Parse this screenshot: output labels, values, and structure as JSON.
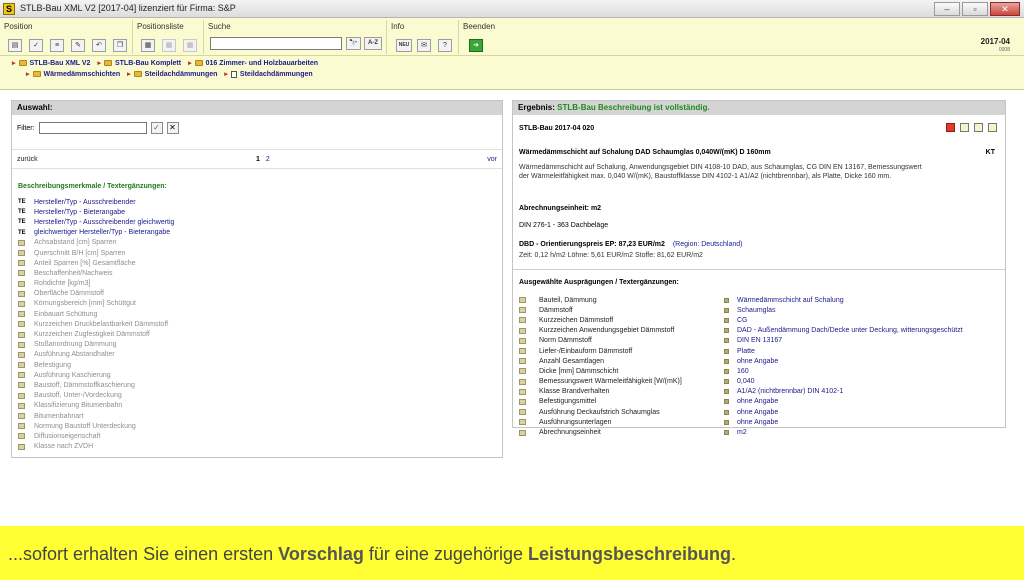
{
  "window": {
    "title": "STLB-Bau XML V2 [2017-04] lizenziert für Firma: S&P",
    "app_icon": "S",
    "minimize": "–",
    "maximize": "▫",
    "close": "✕"
  },
  "ribbon": {
    "groups": [
      "Position",
      "Positionsliste",
      "Suche",
      "Info",
      "Beenden"
    ],
    "search_value": "",
    "search_buttons": [
      "🔭",
      "A-Z"
    ],
    "info_buttons": [
      "NEU",
      "✉",
      "?"
    ],
    "version": "2017-04",
    "build": "0008"
  },
  "breadcrumb": {
    "row1": [
      "STLB-Bau XML V2",
      "STLB-Bau Komplett",
      "016 Zimmer- und Holzbauarbeiten"
    ],
    "row2": [
      "Wärmedämmschichten",
      "Steildachdämmungen",
      "Steildachdämmungen"
    ]
  },
  "left": {
    "header": "Auswahl:",
    "filter_label": "Filter:",
    "filter_value": "",
    "back": "zurück",
    "page_current": "1",
    "page_other": "2",
    "next": "vor",
    "section_title": "Beschreibungsmerkmale / Textergänzungen:",
    "items": [
      {
        "tag": "TE",
        "label": "Hersteller/Typ - Ausschreibender",
        "active": true
      },
      {
        "tag": "TE",
        "label": "Hersteller/Typ - Bieterangabe",
        "active": true
      },
      {
        "tag": "TE",
        "label": "Hersteller/Typ - Ausschreibender gleichwertig",
        "active": true
      },
      {
        "tag": "TE",
        "label": "gleichwertiger Hersteller/Typ - Bieterangabe",
        "active": true
      },
      {
        "tag": "",
        "label": "Achsabstand [cm] Sparren",
        "active": false
      },
      {
        "tag": "",
        "label": "Querschnitt B/H [cm] Sparren",
        "active": false
      },
      {
        "tag": "",
        "label": "Anteil Sparren [%] Gesamtfläche",
        "active": false
      },
      {
        "tag": "",
        "label": "Beschaffenheit/Nachweis",
        "active": false
      },
      {
        "tag": "",
        "label": "Rohdichte [kg/m3]",
        "active": false
      },
      {
        "tag": "",
        "label": "Oberfläche Dämmstoff",
        "active": false
      },
      {
        "tag": "",
        "label": "Körnungsbereich [mm] Schüttgut",
        "active": false
      },
      {
        "tag": "",
        "label": "Einbauart Schüttung",
        "active": false
      },
      {
        "tag": "",
        "label": "Kurzzeichen Druckbelastbarkeit Dämmstoff",
        "active": false
      },
      {
        "tag": "",
        "label": "Kurzzeichen Zugfestigkeit Dämmstoff",
        "active": false
      },
      {
        "tag": "",
        "label": "Stoßanordnung Dämmung",
        "active": false
      },
      {
        "tag": "",
        "label": "Ausführung Abstandhalter",
        "active": false
      },
      {
        "tag": "",
        "label": "Befestigung",
        "active": false
      },
      {
        "tag": "",
        "label": "Ausführung Kaschierung",
        "active": false
      },
      {
        "tag": "",
        "label": "Baustoff, Dämmstoffkaschierung",
        "active": false
      },
      {
        "tag": "",
        "label": "Baustoff, Unter-/Vordeckung",
        "active": false
      },
      {
        "tag": "",
        "label": "Klassifizierung Bitumenbahn",
        "active": false
      },
      {
        "tag": "",
        "label": "Bitumenbahnart",
        "active": false
      },
      {
        "tag": "",
        "label": "Normung Baustoff Unterdeckung",
        "active": false
      },
      {
        "tag": "",
        "label": "Diffusionseigenschaft",
        "active": false
      },
      {
        "tag": "",
        "label": "Klasse nach ZVDH",
        "active": false
      }
    ]
  },
  "right": {
    "header_label": "Ergebnis:",
    "header_status": "STLB-Bau Beschreibung ist vollständig.",
    "version_line": "STLB-Bau 2017-04 020",
    "title": "Wärmedämmschicht auf Schalung DAD Schaumglas 0,040W/(mK) D 160mm",
    "kt": "KT",
    "description": "Wärmedämmschicht auf Schalung, Anwendungsgebiet DIN 4108-10 DAD, aus Schaumglas, CG DIN EN 13167, Bemessungswert der Wärmeleitfähigkeit max. 0,040 W/(mK), Baustoffklasse DIN 4102-1 A1/A2 (nichtbrennbar), als Platte, Dicke 160 mm.",
    "unit": "Abrechnungseinheit: m2",
    "din": "DIN 276-1 - 363 Dachbeläge",
    "price": "DBD - Orientierungspreis EP: 87,23 EUR/m2",
    "region": "(Region: Deutschland)",
    "time": "Zeit: 0,12 h/m2   Löhne: 5,61 EUR/m2   Stoffe: 81,62 EUR/m2",
    "selected_title": "Ausgewählte Ausprägungen / Textergänzungen:",
    "selected": [
      {
        "key": "Bauteil, Dämmung",
        "value": "Wärmedämmschicht auf Schalung"
      },
      {
        "key": "Dämmstoff",
        "value": "Schaumglas"
      },
      {
        "key": "Kurzzeichen Dämmstoff",
        "value": "CG"
      },
      {
        "key": "Kurzzeichen Anwendungsgebiet Dämmstoff",
        "value": "DAD - Außendämmung Dach/Decke unter Deckung, witterungsgeschützt"
      },
      {
        "key": "Norm Dämmstoff",
        "value": "DIN EN 13167"
      },
      {
        "key": "Liefer-/Einbauform Dämmstoff",
        "value": "Platte"
      },
      {
        "key": "Anzahl Gesamtlagen",
        "value": "ohne Angabe"
      },
      {
        "key": "Dicke [mm] Dämmschicht",
        "value": "160"
      },
      {
        "key": "Bemessungswert Wärmeleitfähigkeit [W/(mK)]",
        "value": "0,040"
      },
      {
        "key": "Klasse Brandverhalten",
        "value": "A1/A2 (nichtbrennbar) DIN 4102-1"
      },
      {
        "key": "Befestigungsmittel",
        "value": "ohne Angabe"
      },
      {
        "key": "Ausführung Deckaufstrich Schaumglas",
        "value": "ohne Angabe"
      },
      {
        "key": "Ausführungsunterlagen",
        "value": "ohne Angabe"
      },
      {
        "key": "Abrechnungseinheit",
        "value": "m2"
      }
    ]
  },
  "caption": {
    "pre": "...sofort erhalten Sie einen ersten ",
    "bold1": "Vorschlag",
    "mid": " für eine zugehörige ",
    "bold2": "Leistungsbeschreibung",
    "post": "."
  }
}
